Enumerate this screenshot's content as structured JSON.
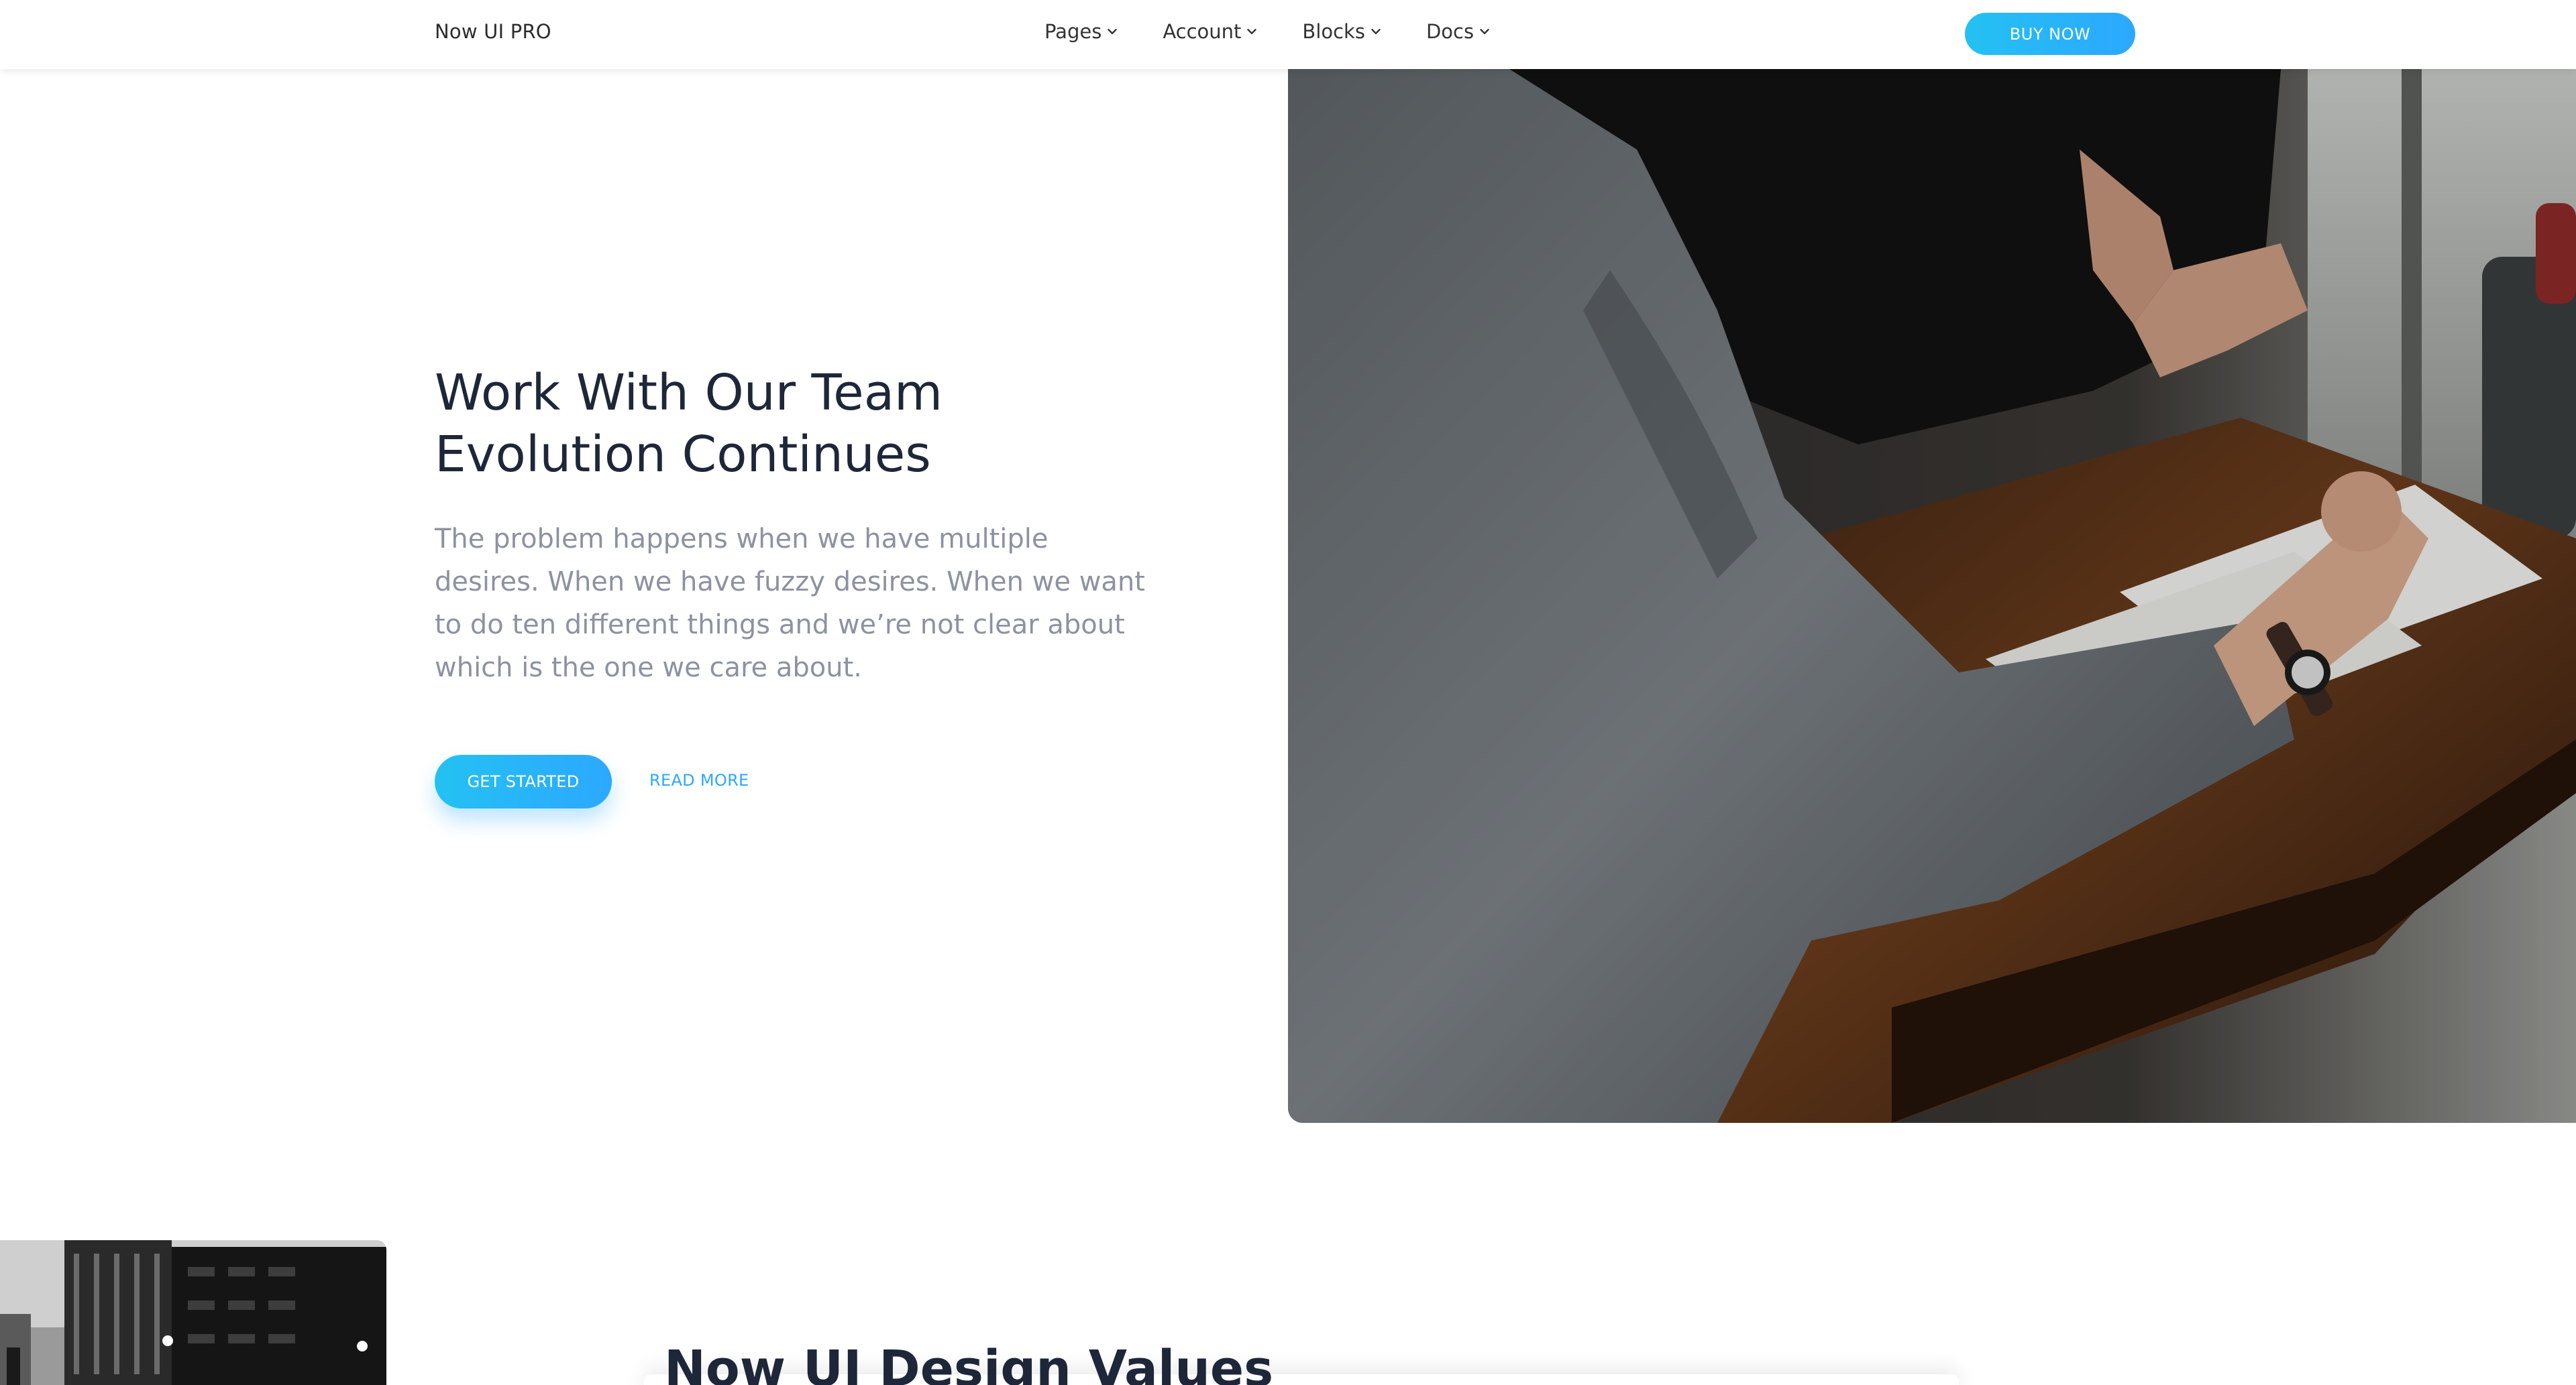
{
  "navbar": {
    "brand": "Now UI PRO",
    "items": [
      {
        "label": "Pages"
      },
      {
        "label": "Account"
      },
      {
        "label": "Blocks"
      },
      {
        "label": "Docs"
      }
    ],
    "cta_label": "BUY NOW"
  },
  "hero": {
    "title_lines": [
      "Work With Our Team",
      "Evolution Continues"
    ],
    "description_lines": [
      "The problem happens when we have multiple",
      "desires. When we have fuzzy desires. When we want",
      "to do ten different things and we’re not clear about",
      "which is the one we care about."
    ],
    "primary_button": "GET STARTED",
    "secondary_link": "READ MORE"
  },
  "section2": {
    "title": "Now UI Design Values"
  },
  "colors": {
    "accent": "#2ca8ff",
    "accent_light": "#24c1f2",
    "heading": "#1e2739",
    "muted_text": "#8c92a2"
  }
}
